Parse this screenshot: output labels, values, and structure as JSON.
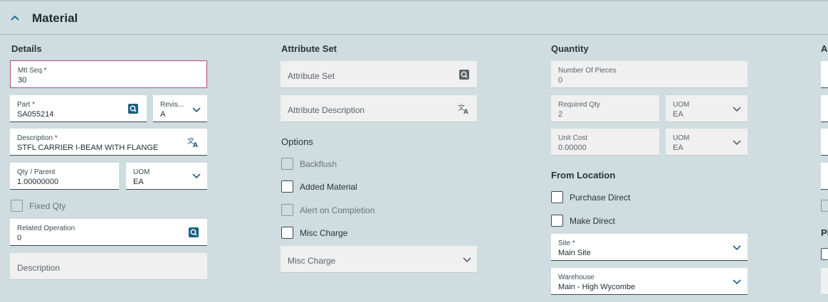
{
  "panel": {
    "title": "Material"
  },
  "details": {
    "heading": "Details",
    "mtl_seq": {
      "label": "Mtl Seq *",
      "value": "30"
    },
    "part": {
      "label": "Part *",
      "value": "SA055214"
    },
    "revision": {
      "label": "Revis...",
      "value": "A"
    },
    "description": {
      "label": "Description *",
      "value": "STFL CARRIER I-BEAM WITH FLANGE"
    },
    "qty_parent": {
      "label": "Qty / Parent",
      "value": "1.00000000"
    },
    "uom": {
      "label": "UOM",
      "value": "EA"
    },
    "fixed_qty": {
      "label": "Fixed Qty"
    },
    "related_operation": {
      "label": "Related Operation",
      "value": "0"
    },
    "description2": {
      "placeholder": "Description"
    }
  },
  "attribute_set": {
    "heading": "Attribute Set",
    "attribute_set": {
      "placeholder": "Attribute Set"
    },
    "attribute_description": {
      "placeholder": "Attribute Description"
    }
  },
  "options": {
    "heading": "Options",
    "backflush": "Backflush",
    "added_material": "Added Material",
    "alert_on_completion": "Alert on Completion",
    "misc_charge": "Misc Charge",
    "misc_charge_select": {
      "placeholder": "Misc Charge"
    }
  },
  "quantity": {
    "heading": "Quantity",
    "number_of_pieces": {
      "label": "Number Of Pieces",
      "value": "0"
    },
    "required_qty": {
      "label": "Required Qty",
      "value": "2"
    },
    "required_uom": {
      "label": "UOM",
      "value": "EA"
    },
    "unit_cost": {
      "label": "Unit Cost",
      "value": "0.00000"
    },
    "cost_uom": {
      "label": "UOM",
      "value": "EA"
    }
  },
  "from_location": {
    "heading": "From Location",
    "purchase_direct": "Purchase Direct",
    "make_direct": "Make Direct",
    "site": {
      "label": "Site *",
      "value": "Main Site"
    },
    "warehouse": {
      "label": "Warehouse",
      "value": "Main - High Wycombe"
    }
  },
  "partial_right": {
    "heading1": "Ac",
    "heading2": "Pl"
  },
  "colors": {
    "accent": "#1b5f80",
    "background": "#cfdde0",
    "error_border": "#b44a7a"
  }
}
